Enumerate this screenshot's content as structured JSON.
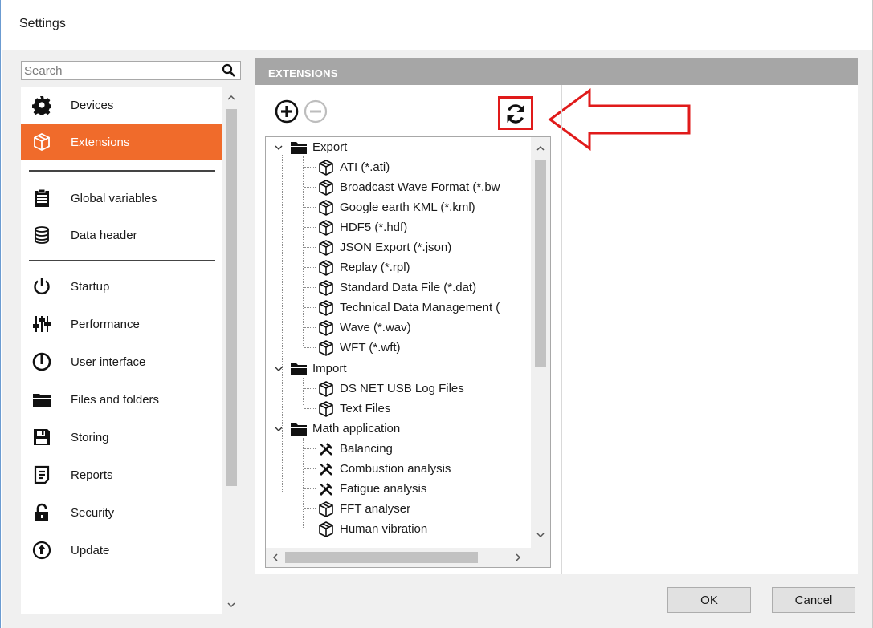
{
  "window": {
    "title": "Settings"
  },
  "search": {
    "placeholder": "Search"
  },
  "sidebar": {
    "items": [
      {
        "label": "Devices",
        "icon": "gear-icon"
      },
      {
        "label": "Extensions",
        "icon": "package-icon",
        "selected": true
      },
      {
        "label": "Global variables",
        "icon": "clipboard-icon"
      },
      {
        "label": "Data header",
        "icon": "database-icon"
      },
      {
        "label": "Startup",
        "icon": "power-icon"
      },
      {
        "label": "Performance",
        "icon": "sliders-icon"
      },
      {
        "label": "User interface",
        "icon": "gauge-icon"
      },
      {
        "label": "Files and folders",
        "icon": "folder-icon"
      },
      {
        "label": "Storing",
        "icon": "save-icon"
      },
      {
        "label": "Reports",
        "icon": "report-icon"
      },
      {
        "label": "Security",
        "icon": "lock-icon"
      },
      {
        "label": "Update",
        "icon": "update-icon"
      }
    ]
  },
  "panel": {
    "header": "EXTENSIONS"
  },
  "tree": {
    "groups": [
      {
        "label": "Export",
        "children": [
          "ATI (*.ati)",
          "Broadcast Wave Format (*.bw",
          "Google earth KML (*.kml)",
          "HDF5 (*.hdf)",
          "JSON Export (*.json)",
          "Replay (*.rpl)",
          "Standard Data File (*.dat)",
          "Technical Data Management (",
          "Wave (*.wav)",
          "WFT (*.wft)"
        ]
      },
      {
        "label": "Import",
        "children": [
          "DS NET USB Log Files",
          "Text Files"
        ]
      },
      {
        "label": "Math application",
        "children": [
          "Balancing",
          "Combustion analysis",
          "Fatigue analysis",
          "FFT analyser",
          "Human vibration"
        ]
      }
    ]
  },
  "buttons": {
    "ok": "OK",
    "cancel": "Cancel"
  },
  "colors": {
    "accent": "#f06b2b",
    "header": "#a6a6a6",
    "annotation": "#e01a1a"
  }
}
